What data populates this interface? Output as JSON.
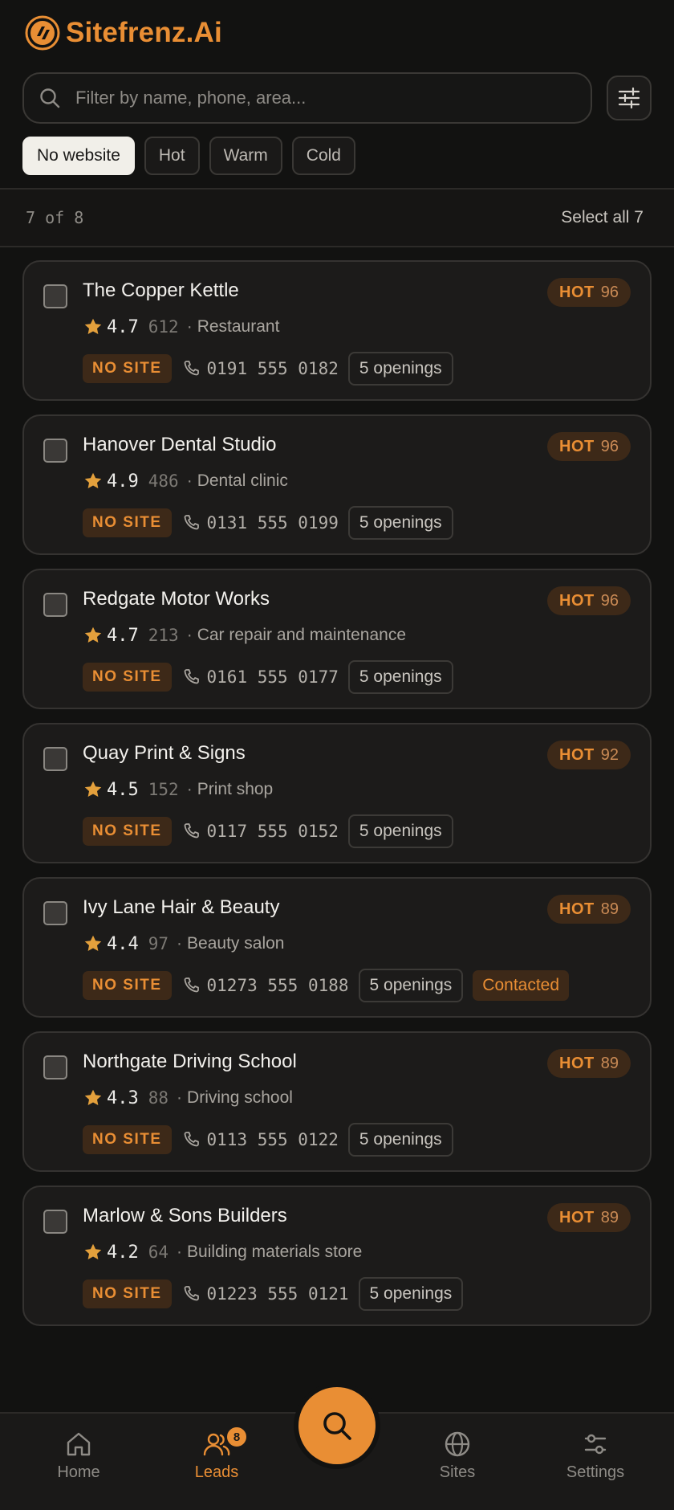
{
  "app": {
    "name": "Sitefrenz.Ai",
    "accent": "#e98e34"
  },
  "search": {
    "placeholder": "Filter by name, phone, area..."
  },
  "filters": [
    {
      "label": "No website",
      "active": true
    },
    {
      "label": "Hot",
      "active": false
    },
    {
      "label": "Warm",
      "active": false
    },
    {
      "label": "Cold",
      "active": false
    }
  ],
  "summary": {
    "count_text": "7 of 8",
    "select_all_label": "Select all 7"
  },
  "leads": [
    {
      "name": "The Copper Kettle",
      "rating": "4.7",
      "reviews": "612",
      "category": "Restaurant",
      "site_status": "NO SITE",
      "phone": "0191 555 0182",
      "openings": "5 openings",
      "temp": "HOT",
      "score": "96",
      "contacted": null
    },
    {
      "name": "Hanover Dental Studio",
      "rating": "4.9",
      "reviews": "486",
      "category": "Dental clinic",
      "site_status": "NO SITE",
      "phone": "0131 555 0199",
      "openings": "5 openings",
      "temp": "HOT",
      "score": "96",
      "contacted": null
    },
    {
      "name": "Redgate Motor Works",
      "rating": "4.7",
      "reviews": "213",
      "category": "Car repair and maintenance",
      "site_status": "NO SITE",
      "phone": "0161 555 0177",
      "openings": "5 openings",
      "temp": "HOT",
      "score": "96",
      "contacted": null
    },
    {
      "name": "Quay Print & Signs",
      "rating": "4.5",
      "reviews": "152",
      "category": "Print shop",
      "site_status": "NO SITE",
      "phone": "0117 555 0152",
      "openings": "5 openings",
      "temp": "HOT",
      "score": "92",
      "contacted": null
    },
    {
      "name": "Ivy Lane Hair & Beauty",
      "rating": "4.4",
      "reviews": "97",
      "category": "Beauty salon",
      "site_status": "NO SITE",
      "phone": "01273 555 0188",
      "openings": "5 openings",
      "temp": "HOT",
      "score": "89",
      "contacted": "Contacted"
    },
    {
      "name": "Northgate Driving School",
      "rating": "4.3",
      "reviews": "88",
      "category": "Driving school",
      "site_status": "NO SITE",
      "phone": "0113 555 0122",
      "openings": "5 openings",
      "temp": "HOT",
      "score": "89",
      "contacted": null
    },
    {
      "name": "Marlow & Sons Builders",
      "rating": "4.2",
      "reviews": "64",
      "category": "Building materials store",
      "site_status": "NO SITE",
      "phone": "01223 555 0121",
      "openings": "5 openings",
      "temp": "HOT",
      "score": "89",
      "contacted": null
    }
  ],
  "nav": {
    "home": "Home",
    "leads": "Leads",
    "leads_badge": "8",
    "sites": "Sites",
    "settings": "Settings",
    "active": "leads"
  }
}
